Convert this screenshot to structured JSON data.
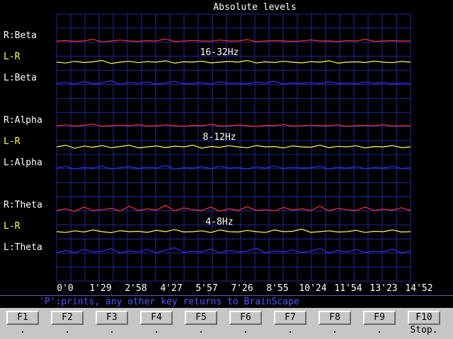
{
  "chart_data": {
    "type": "line",
    "title": "Absolute levels",
    "x_tick_labels": [
      "0'0",
      "1'29",
      "2'58",
      "4'27",
      "5'57",
      "7'26",
      "8'55",
      "10'24",
      "11'54",
      "13'23",
      "14'52"
    ],
    "grid": true,
    "bands": [
      {
        "label": "16-32Hz",
        "series": [
          {
            "name": "R:Beta",
            "color": "#ff3030",
            "values": [
              0.5,
              0.52,
              0.48,
              0.5,
              0.6,
              0.45,
              0.5,
              0.55,
              0.5,
              0.48,
              0.52,
              0.5,
              0.62,
              0.47,
              0.5,
              0.53,
              0.5,
              0.49,
              0.55,
              0.5,
              0.5,
              0.58,
              0.46,
              0.5,
              0.52,
              0.5,
              0.48,
              0.5,
              0.56,
              0.5,
              0.5,
              0.47,
              0.52,
              0.5,
              0.6,
              0.48,
              0.5,
              0.52,
              0.5,
              0.5
            ]
          },
          {
            "name": "L-R",
            "color": "#ffff50",
            "values": [
              0.5,
              0.45,
              0.55,
              0.48,
              0.52,
              0.6,
              0.42,
              0.5,
              0.55,
              0.47,
              0.53,
              0.5,
              0.58,
              0.44,
              0.52,
              0.5,
              0.56,
              0.46,
              0.5,
              0.54,
              0.5,
              0.6,
              0.45,
              0.52,
              0.48,
              0.55,
              0.5,
              0.46,
              0.53,
              0.5,
              0.58,
              0.44,
              0.5,
              0.52,
              0.48,
              0.56,
              0.5,
              0.47,
              0.54,
              0.5
            ]
          },
          {
            "name": "L:Beta",
            "color": "#3030ff",
            "values": [
              0.5,
              0.55,
              0.45,
              0.6,
              0.48,
              0.52,
              0.65,
              0.45,
              0.55,
              0.5,
              0.58,
              0.46,
              0.52,
              0.62,
              0.48,
              0.5,
              0.55,
              0.45,
              0.6,
              0.5,
              0.52,
              0.48,
              0.58,
              0.5,
              0.63,
              0.46,
              0.52,
              0.5,
              0.55,
              0.48,
              0.6,
              0.5,
              0.52,
              0.47,
              0.57,
              0.5,
              0.54,
              0.48,
              0.52,
              0.5
            ]
          }
        ]
      },
      {
        "label": "8-12Hz",
        "series": [
          {
            "name": "R:Alpha",
            "color": "#ff3030",
            "values": [
              0.5,
              0.55,
              0.48,
              0.52,
              0.6,
              0.47,
              0.5,
              0.53,
              0.5,
              0.56,
              0.48,
              0.5,
              0.55,
              0.5,
              0.47,
              0.52,
              0.5,
              0.58,
              0.48,
              0.5,
              0.54,
              0.5,
              0.46,
              0.52,
              0.5,
              0.57,
              0.48,
              0.5,
              0.53,
              0.5,
              0.5,
              0.55,
              0.47,
              0.5,
              0.52,
              0.5,
              0.56,
              0.48,
              0.5,
              0.5
            ]
          },
          {
            "name": "L-R",
            "color": "#ffff50",
            "values": [
              0.5,
              0.6,
              0.42,
              0.55,
              0.48,
              0.58,
              0.45,
              0.52,
              0.6,
              0.44,
              0.5,
              0.56,
              0.46,
              0.54,
              0.5,
              0.6,
              0.43,
              0.52,
              0.48,
              0.57,
              0.5,
              0.45,
              0.58,
              0.5,
              0.52,
              0.44,
              0.56,
              0.5,
              0.48,
              0.6,
              0.46,
              0.53,
              0.5,
              0.57,
              0.44,
              0.52,
              0.5,
              0.58,
              0.46,
              0.5
            ]
          },
          {
            "name": "L:Alpha",
            "color": "#3030ff",
            "values": [
              0.5,
              0.6,
              0.45,
              0.55,
              0.5,
              0.62,
              0.46,
              0.52,
              0.58,
              0.48,
              0.55,
              0.5,
              0.65,
              0.45,
              0.52,
              0.5,
              0.58,
              0.47,
              0.6,
              0.5,
              0.53,
              0.46,
              0.57,
              0.5,
              0.62,
              0.48,
              0.55,
              0.5,
              0.52,
              0.6,
              0.46,
              0.55,
              0.5,
              0.58,
              0.47,
              0.53,
              0.5,
              0.6,
              0.48,
              0.52
            ]
          }
        ]
      },
      {
        "label": "4-8Hz",
        "series": [
          {
            "name": "R:Theta",
            "color": "#ff3030",
            "values": [
              0.5,
              0.6,
              0.45,
              0.7,
              0.5,
              0.55,
              0.62,
              0.48,
              0.75,
              0.5,
              0.6,
              0.52,
              0.8,
              0.48,
              0.65,
              0.55,
              0.5,
              0.7,
              0.45,
              0.6,
              0.5,
              0.72,
              0.5,
              0.55,
              0.48,
              0.68,
              0.52,
              0.6,
              0.5,
              0.75,
              0.48,
              0.62,
              0.55,
              0.5,
              0.7,
              0.5,
              0.58,
              0.52,
              0.66,
              0.5
            ]
          },
          {
            "name": "L-R",
            "color": "#ffff50",
            "values": [
              0.5,
              0.45,
              0.55,
              0.48,
              0.6,
              0.5,
              0.44,
              0.56,
              0.5,
              0.52,
              0.46,
              0.58,
              0.5,
              0.62,
              0.48,
              0.5,
              0.55,
              0.45,
              0.6,
              0.5,
              0.48,
              0.57,
              0.5,
              0.45,
              0.6,
              0.5,
              0.52,
              0.65,
              0.46,
              0.5,
              0.55,
              0.48,
              0.5,
              0.58,
              0.45,
              0.52,
              0.5,
              0.6,
              0.48,
              0.5
            ]
          },
          {
            "name": "L:Theta",
            "color": "#3030ff",
            "values": [
              0.5,
              0.65,
              0.5,
              0.7,
              0.55,
              0.6,
              0.75,
              0.5,
              0.62,
              0.55,
              0.7,
              0.5,
              0.66,
              0.8,
              0.52,
              0.6,
              0.55,
              0.72,
              0.5,
              0.65,
              0.55,
              0.6,
              0.78,
              0.5,
              0.62,
              0.55,
              0.68,
              0.52,
              0.6,
              0.75,
              0.5,
              0.64,
              0.55,
              0.7,
              0.52,
              0.6,
              0.55,
              0.72,
              0.5,
              0.6
            ]
          }
        ]
      }
    ]
  },
  "status_message": "'P':prints, any other key returns to BrainScape",
  "function_keys": [
    {
      "label": "F1",
      "sub": "."
    },
    {
      "label": "F2",
      "sub": "."
    },
    {
      "label": "F3",
      "sub": "."
    },
    {
      "label": "F4",
      "sub": "."
    },
    {
      "label": "F5",
      "sub": "."
    },
    {
      "label": "F6",
      "sub": "."
    },
    {
      "label": "F7",
      "sub": "."
    },
    {
      "label": "F8",
      "sub": "."
    },
    {
      "label": "F9",
      "sub": "."
    },
    {
      "label": "F10",
      "sub": "Stop."
    }
  ]
}
